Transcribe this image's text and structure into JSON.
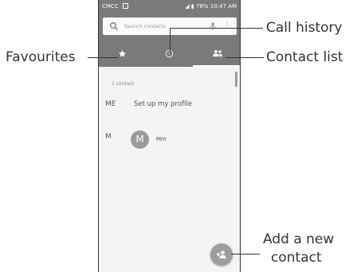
{
  "statusbar": {
    "carrier": "CMCC",
    "battery": "78%",
    "time": "10:47 AM",
    "right_text": "78% 10:47 AM"
  },
  "search": {
    "placeholder": "Search contacts",
    "icons": [
      "search-icon",
      "mic-icon",
      "more-vert-icon"
    ]
  },
  "tabs": [
    {
      "name": "favourites",
      "icon": "star-icon"
    },
    {
      "name": "call-history",
      "icon": "clock-icon"
    },
    {
      "name": "contacts",
      "icon": "people-icon",
      "selected": true
    }
  ],
  "list": {
    "count_text": "1 contact",
    "rows": [
      {
        "letter": "ME",
        "text": "Set up my profile"
      },
      {
        "letter": "M",
        "avatar_letter": "M",
        "text": "Mm"
      }
    ]
  },
  "fab": {
    "icon": "add-contact-icon"
  },
  "callouts": {
    "favourites": "Favourites",
    "call_history": "Call history",
    "contact_list": "Contact list",
    "add_new_line1": "Add a new",
    "add_new_line2": "contact"
  },
  "colors": {
    "toolbar": "#7a7a7a",
    "background": "#f4f4f4",
    "fab": "#9e9e9e"
  }
}
